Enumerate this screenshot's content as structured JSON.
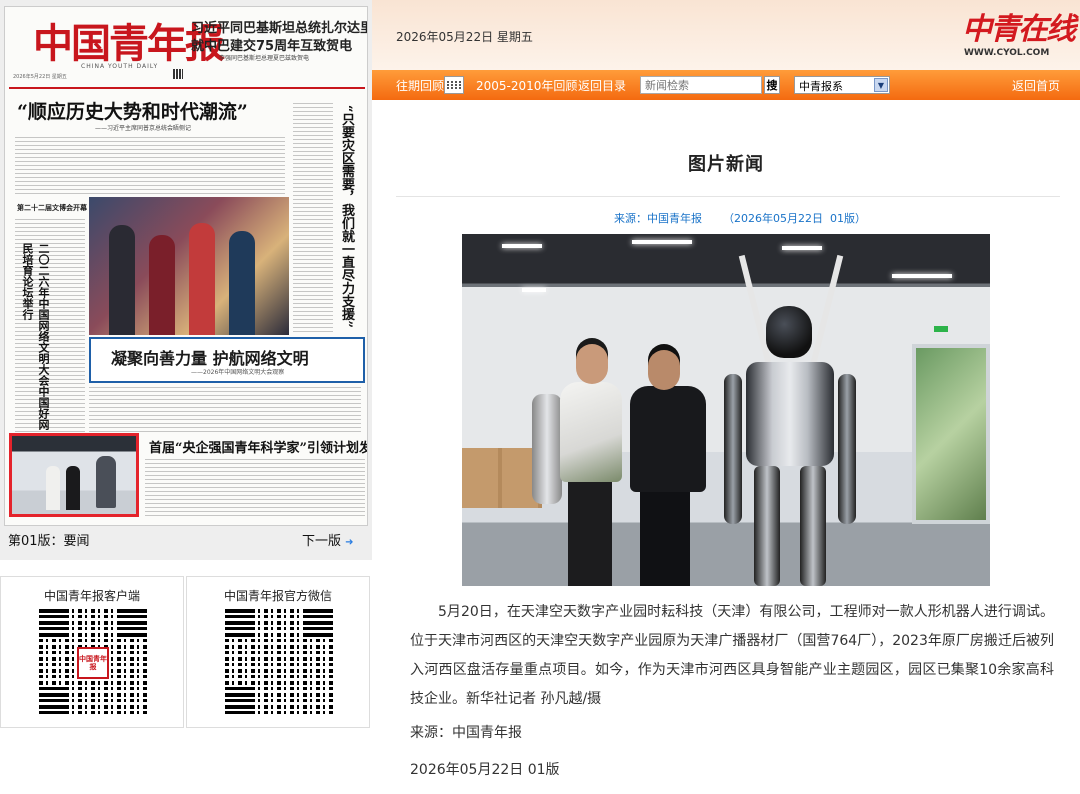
{
  "header": {
    "date": "2026年05月22日  星期五",
    "logo_text": "中青在线",
    "logo_url": "WWW.CYOL.COM"
  },
  "nav": {
    "past_review": "往期回顾",
    "archive": "2005-2010年回顾",
    "back_to_toc": "返回目录",
    "search_placeholder": "新闻检索",
    "search_button": "搜",
    "series_select": "中青报系",
    "home": "返回首页"
  },
  "newspaper": {
    "masthead": "中国青年报",
    "masthead_en": "CHINA YOUTH DAILY",
    "masthead_date": "2026年5月22日 星期五",
    "headline_top_1": "习近平同巴基斯坦总统扎尔达里",
    "headline_top_2": "就中巴建交75周年互致贺电",
    "headline_top_sub": "李强同巴基斯坦总理夏巴兹致贺电",
    "headline_main": "“顺应历史大势和时代潮流”",
    "headline_main_sub": "——习近平主席同普京总统会晤侧记",
    "section_label": "第二十二届文博会开幕",
    "vertical_left": "二〇二六年中国网络文明大会中国好网民培育论坛举行",
    "vertical_right": "“只要灾区需要，我们就一直尽力支援”",
    "blue_headline": "凝聚向善力量 护航网络文明",
    "blue_sub": "——2026年中国网络文明大会观察",
    "science_headline": "首届“央企强国青年科学家”引领计划发布",
    "page_label": "第01版：要闻",
    "next_page": "下一版"
  },
  "qr": {
    "client_title": "中国青年报客户端",
    "wechat_title": "中国青年报官方微信",
    "center_label": "中国青年报"
  },
  "article": {
    "title": "图片新闻",
    "source_line": "来源：中国青年报      （2026年05月22日  01版）",
    "caption": "5月20日，在天津空天数字产业园时耘科技（天津）有限公司，工程师对一款人形机器人进行调试。位于天津市河西区的天津空天数字产业园原为天津广播器材厂（国营764厂），2023年原厂房搬迁后被列入河西区盘活存量重点项目。如今，作为天津市河西区具身智能产业主题园区，园区已集聚10余家高科技企业。新华社记者 孙凡越/摄",
    "source_bottom": "来源：中国青年报",
    "date_bottom": "2026年05月22日  01版"
  },
  "colors": {
    "brand_red": "#c8161d",
    "nav_orange": "#f46a10",
    "link_blue": "#1a73c8"
  }
}
